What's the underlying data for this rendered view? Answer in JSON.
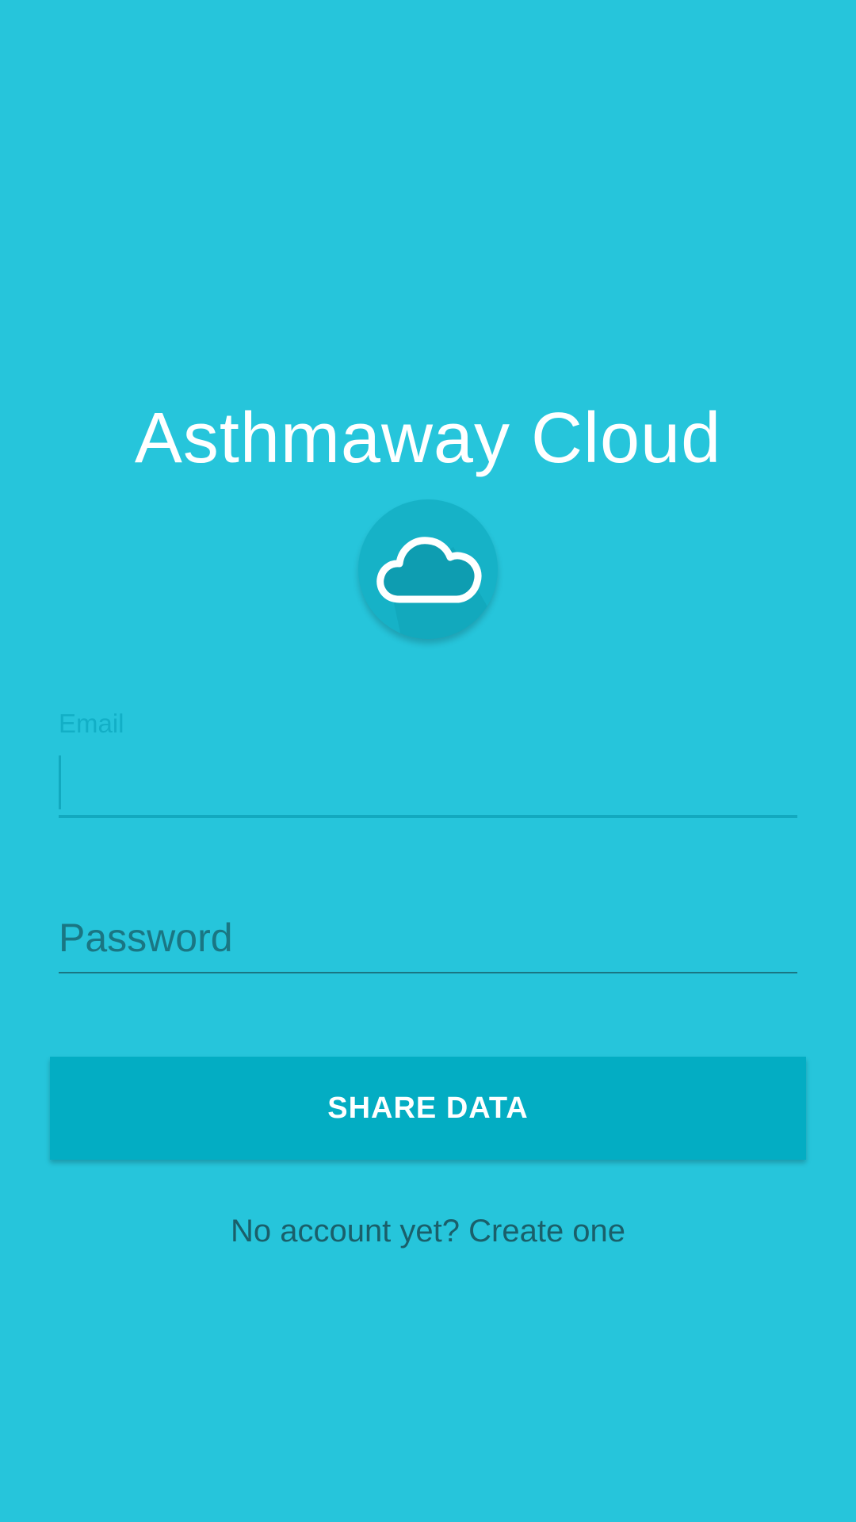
{
  "app": {
    "title": "Asthmaway Cloud",
    "logo_icon": "cloud-icon"
  },
  "form": {
    "email_label": "Email",
    "email_value": "",
    "password_placeholder": "Password",
    "password_value": ""
  },
  "actions": {
    "share_label": "SHARE DATA",
    "create_account_link": "No account yet? Create one"
  },
  "colors": {
    "background": "#26c5db",
    "accent": "#03adc3",
    "text_dark": "#1a5f6a"
  }
}
